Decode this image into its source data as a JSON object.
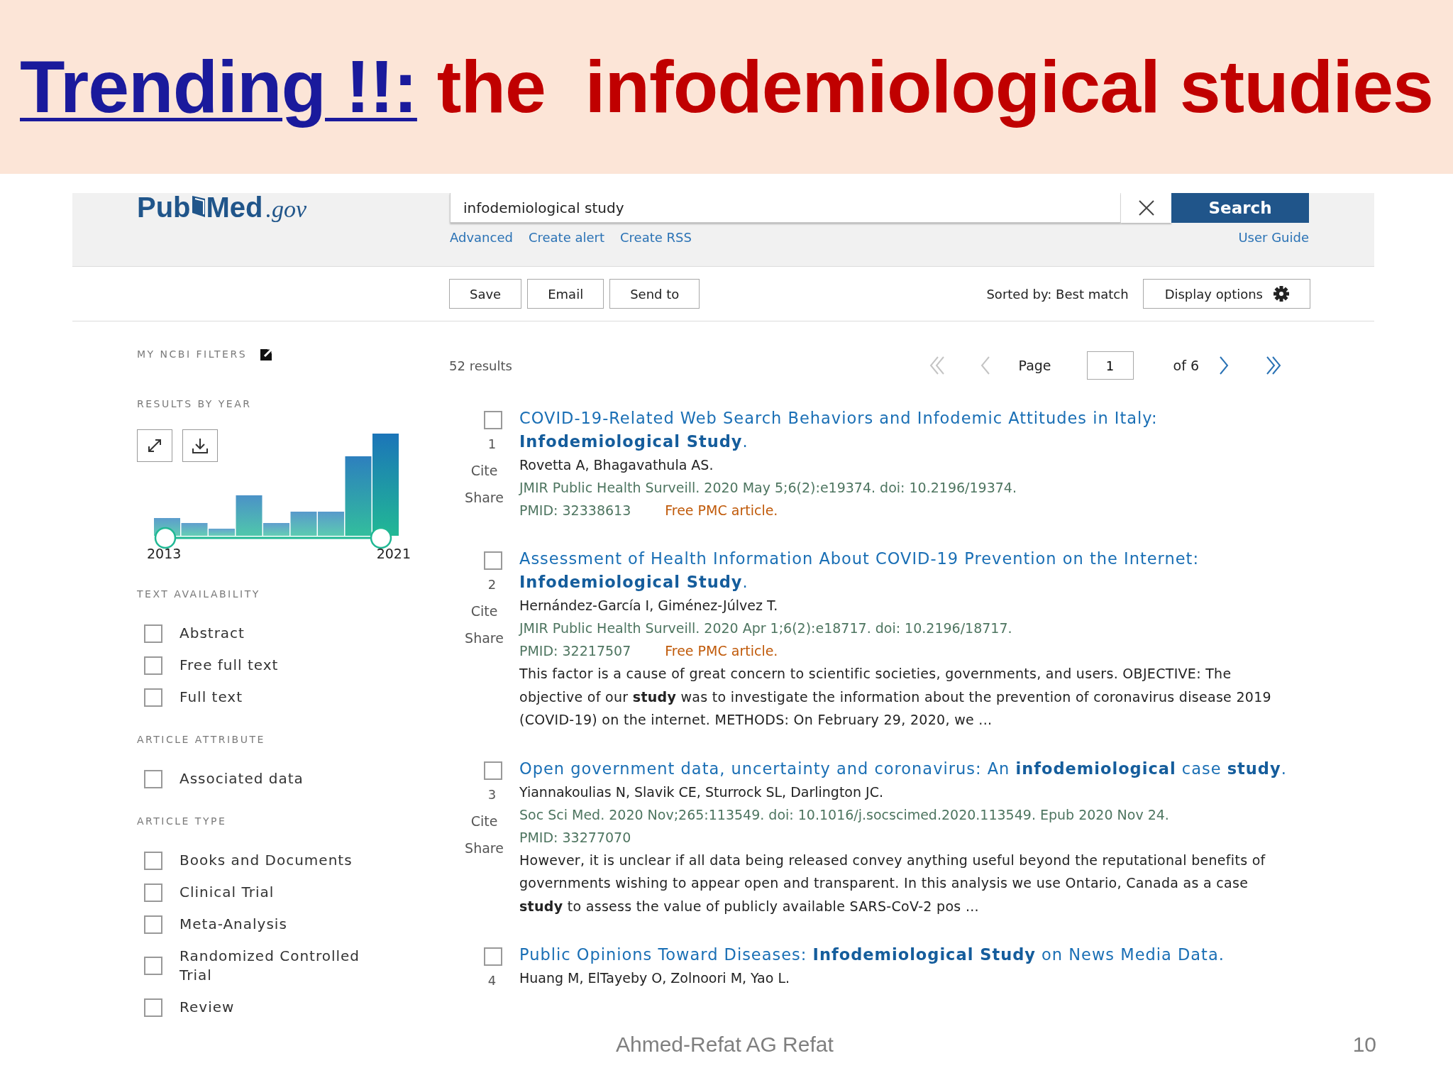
{
  "slide_title": {
    "highlight": "Trending !!:",
    "text": "the  infodemiological studies"
  },
  "header": {
    "logo": {
      "name_start": "Pub",
      "name_end": "Med",
      "domain": ".gov"
    },
    "search": {
      "value": "infodemiological study",
      "button": "Search"
    },
    "links": [
      "Advanced",
      "Create alert",
      "Create RSS"
    ],
    "user_guide": "User Guide"
  },
  "toolbar": {
    "buttons": [
      "Save",
      "Email",
      "Send to"
    ],
    "sort_label": "Sorted by: Best match",
    "display_options": "Display options"
  },
  "sidebar": {
    "my_ncbi_filters": "MY NCBI FILTERS",
    "results_by_year": {
      "title": "RESULTS BY YEAR",
      "start_year": "2013",
      "end_year": "2021",
      "range_thumbs": [
        {
          "level": 0
        },
        {
          "level": 1
        }
      ]
    },
    "filter_groups": [
      {
        "title": "TEXT AVAILABILITY",
        "items": [
          {
            "label": "Abstract",
            "checked": false
          },
          {
            "label": "Free full text",
            "checked": false
          },
          {
            "label": "Full text",
            "checked": false
          }
        ]
      },
      {
        "title": "ARTICLE ATTRIBUTE",
        "items": [
          {
            "label": "Associated data",
            "checked": false
          }
        ]
      },
      {
        "title": "ARTICLE TYPE",
        "items": [
          {
            "label": "Books and Documents",
            "checked": false
          },
          {
            "label": "Clinical Trial",
            "checked": false
          },
          {
            "label": "Meta-Analysis",
            "checked": false
          },
          {
            "label": "Randomized Controlled Trial",
            "checked": false
          },
          {
            "label": "Review",
            "checked": false
          }
        ]
      }
    ]
  },
  "results_header": {
    "count": "52 results",
    "pager": {
      "before": [
        {
          "kind": "first",
          "disabled": true
        },
        {
          "kind": "previous",
          "disabled": true
        }
      ],
      "label": "Page",
      "value": "1",
      "of": "of 6",
      "after": [
        {
          "kind": "next",
          "disabled": false
        },
        {
          "kind": "last",
          "disabled": false
        }
      ]
    }
  },
  "results": [
    {
      "number": "1",
      "checked": false,
      "cite": "Cite",
      "share": "Share",
      "title": "COVID-19-Related Web Search Behaviors and Infodemic Attitudes in Italy: **Infodemiological Study**.",
      "authors": "Rovetta A, Bhagavathula AS.",
      "citation": "JMIR Public Health Surveill. 2020 May 5;6(2):e19374. doi: 10.2196/19374.",
      "pmid": "PMID: 32338613",
      "free_pmc": "Free PMC article."
    },
    {
      "number": "2",
      "checked": false,
      "cite": "Cite",
      "share": "Share",
      "title": "Assessment of Health Information About COVID-19 Prevention on the Internet: **Infodemiological Study**.",
      "authors": "Hernández-García I, Giménez-Júlvez T.",
      "citation": "JMIR Public Health Surveill. 2020 Apr 1;6(2):e18717. doi: 10.2196/18717.",
      "pmid": "PMID: 32217507",
      "free_pmc": "Free PMC article.",
      "snippet": "This factor is a cause of great concern to scientific societies, governments, and users. OBJECTIVE: The objective of our **study** was to investigate the information about the prevention of coronavirus disease 2019 (COVID-19) on the internet. METHODS: On February 29, 2020, we ..."
    },
    {
      "number": "3",
      "checked": false,
      "cite": "Cite",
      "share": "Share",
      "title": "Open government data, uncertainty and coronavirus: An **infodemiological** case **study**.",
      "authors": "Yiannakoulias N, Slavik CE, Sturrock SL, Darlington JC.",
      "citation": "Soc Sci Med. 2020 Nov;265:113549. doi: 10.1016/j.socscimed.2020.113549. Epub 2020 Nov 24.",
      "pmid": "PMID: 33277070",
      "snippet": "However, it is unclear if all data being released convey anything useful beyond the reputational benefits of governments wishing to appear open and transparent. In this analysis we use Ontario, Canada as a case **study** to assess the value of publicly available SARS-CoV-2 pos ..."
    },
    {
      "number": "4",
      "checked": false,
      "title": "Public Opinions Toward Diseases: **Infodemiological Study** on News Media Data.",
      "authors": "Huang M, ElTayeby O, Zolnoori M, Yao L."
    }
  ],
  "footer": {
    "author": "Ahmed-Refat AG Refat",
    "page_number": "10"
  }
}
